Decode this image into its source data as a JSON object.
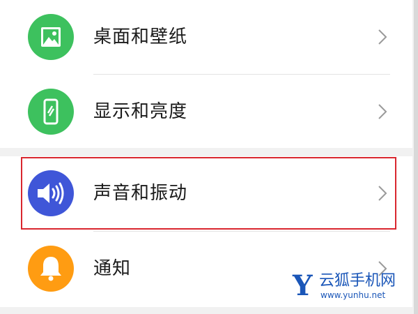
{
  "settings": {
    "items": [
      {
        "label": "桌面和壁纸",
        "icon": "wallpaper-icon",
        "icon_color": "#3dc15e"
      },
      {
        "label": "显示和亮度",
        "icon": "display-brightness-icon",
        "icon_color": "#3dc15e"
      },
      {
        "label": "声音和振动",
        "icon": "sound-vibration-icon",
        "icon_color": "#3f56d8"
      },
      {
        "label": "通知",
        "icon": "bell-icon",
        "icon_color": "#ff9c12"
      }
    ]
  },
  "highlight": {
    "target": "声音和振动",
    "color": "#d9262e"
  },
  "watermark": {
    "logo_letter": "Y",
    "title": "云狐手机网",
    "url": "www.yunhu.net",
    "color": "#1a56b8"
  }
}
